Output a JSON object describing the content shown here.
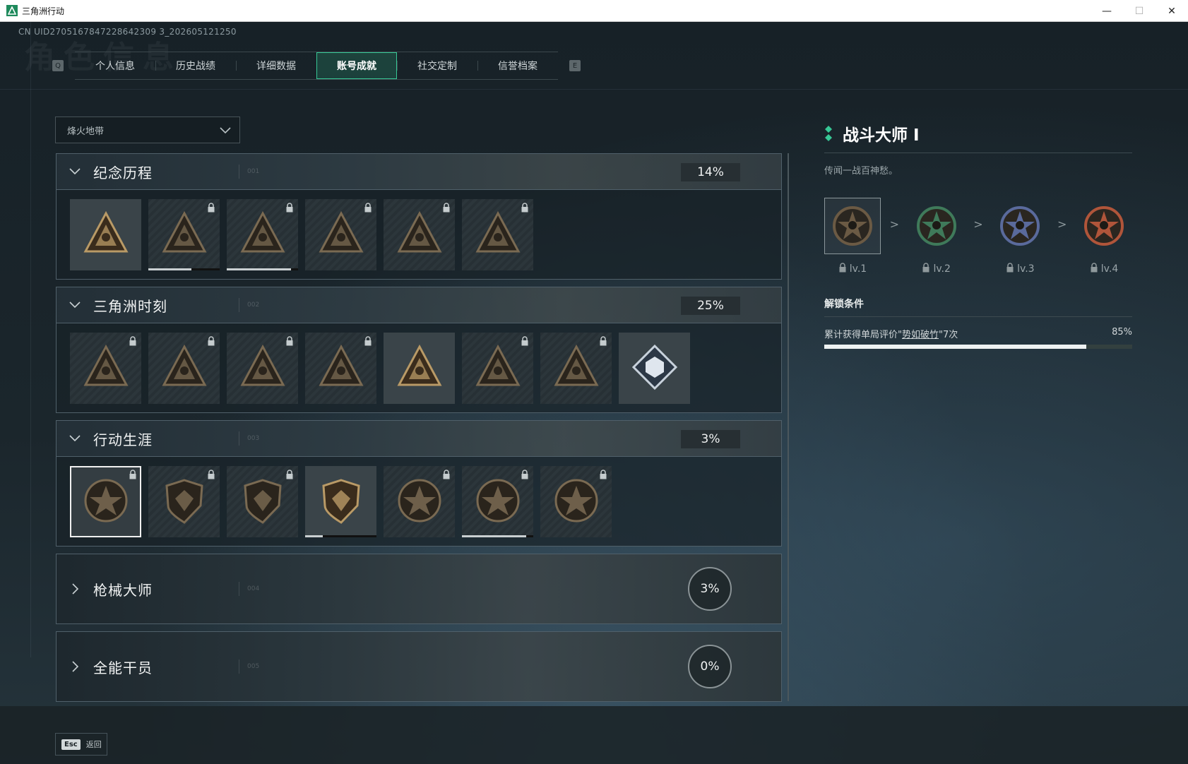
{
  "window": {
    "title": "三角洲行动"
  },
  "header": {
    "uid": "CN UID2705167847228642309 3_202605121250",
    "background_title": "角色信息",
    "left_key": "Q",
    "right_key": "E"
  },
  "tabs": [
    {
      "label": "个人信息",
      "active": false
    },
    {
      "label": "历史战绩",
      "active": false
    },
    {
      "label": "详细数据",
      "active": false
    },
    {
      "label": "账号成就",
      "active": true
    },
    {
      "label": "社交定制",
      "active": false
    },
    {
      "label": "信誉档案",
      "active": false
    }
  ],
  "filter": {
    "selected": "烽火地带"
  },
  "sections": [
    {
      "title": "纪念历程",
      "num": "001",
      "percent": "14%",
      "expanded": true,
      "badges": [
        {
          "icon": "triangle-emblem-icon",
          "locked": false,
          "progress": 0
        },
        {
          "icon": "helicopter-emblem-icon",
          "locked": true,
          "progress": 0.6
        },
        {
          "icon": "shield-emblem-icon",
          "locked": true,
          "progress": 0.9
        },
        {
          "icon": "soldier-emblem-icon",
          "locked": true,
          "progress": 0
        },
        {
          "icon": "hooded-triangle-icon",
          "locked": true,
          "progress": 0
        },
        {
          "icon": "skull-triangle-icon",
          "locked": true,
          "progress": 0
        }
      ]
    },
    {
      "title": "三角洲时刻",
      "num": "002",
      "percent": "25%",
      "expanded": true,
      "badges": [
        {
          "icon": "robot-triangle-icon",
          "locked": true,
          "progress": 0
        },
        {
          "icon": "bird-triangle-icon",
          "locked": true,
          "progress": 0
        },
        {
          "icon": "runner-triangle-icon",
          "locked": true,
          "progress": 0
        },
        {
          "icon": "dice-triangle-icon",
          "locked": true,
          "progress": 0
        },
        {
          "icon": "team-triangle-icon",
          "locked": false,
          "progress": 0
        },
        {
          "icon": "beast-triangle-icon",
          "locked": true,
          "progress": 0
        },
        {
          "icon": "dragon-triangle-icon",
          "locked": true,
          "progress": 0
        },
        {
          "icon": "diamond-cube-icon",
          "locked": false,
          "progress": 0
        }
      ]
    },
    {
      "title": "行动生涯",
      "num": "003",
      "percent": "3%",
      "expanded": true,
      "badges": [
        {
          "icon": "star-medal-icon",
          "locked": true,
          "progress": 0,
          "selected": true
        },
        {
          "icon": "wing-shield-icon",
          "locked": true,
          "progress": 0
        },
        {
          "icon": "arrow-shield-icon",
          "locked": true,
          "progress": 0
        },
        {
          "icon": "gem-shield-icon",
          "locked": false,
          "progress": 0.25
        },
        {
          "icon": "helmet-medal-icon",
          "locked": true,
          "progress": 0
        },
        {
          "icon": "skull-medal-icon",
          "locked": true,
          "progress": 0.9
        },
        {
          "icon": "eye-medal-icon",
          "locked": true,
          "progress": 0
        }
      ]
    },
    {
      "title": "枪械大师",
      "num": "004",
      "percent": "3%",
      "expanded": false
    },
    {
      "title": "全能干员",
      "num": "005",
      "percent": "0%",
      "expanded": false
    }
  ],
  "detail": {
    "name": "战斗大师 I",
    "description": "传闻一战百神愁。",
    "levels": [
      {
        "label": "lv.1",
        "color": "#6b5a44"
      },
      {
        "label": "lv.2",
        "color": "#3f7a5a"
      },
      {
        "label": "lv.3",
        "color": "#5a6a9c"
      },
      {
        "label": "lv.4",
        "color": "#b0553a"
      }
    ],
    "unlock_title": "解锁条件",
    "condition_prefix": "累计获得单局评价\"",
    "condition_link": "势如破竹",
    "condition_suffix": "\"7次",
    "condition_percent": "85%",
    "condition_progress": 0.85
  },
  "footer": {
    "esc_key": "Esc",
    "esc_label": "返回"
  },
  "colors": {
    "accent": "#37c896",
    "panel_border": "#50606a"
  }
}
